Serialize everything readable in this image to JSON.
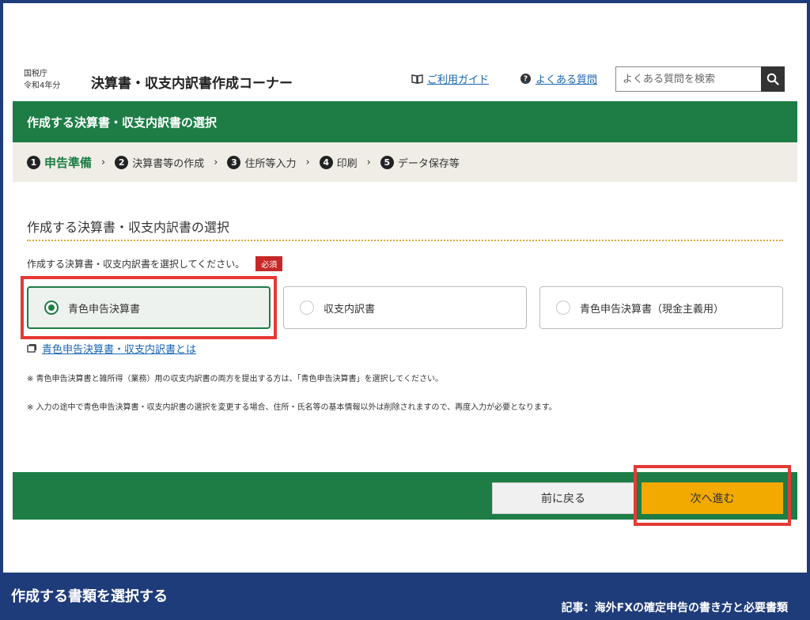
{
  "header": {
    "agency": "国税庁",
    "year": "令和4年分",
    "title": "決算書・収支内訳書作成コーナー",
    "guide_link": "ご利用ガイド",
    "faq_link": "よくある質問",
    "search_placeholder": "よくある質問を検索"
  },
  "page_heading": "作成する決算書・収支内訳書の選択",
  "steps": [
    {
      "num": "1",
      "label": "申告準備"
    },
    {
      "num": "2",
      "label": "決算書等の作成"
    },
    {
      "num": "3",
      "label": "住所等入力"
    },
    {
      "num": "4",
      "label": "印刷"
    },
    {
      "num": "5",
      "label": "データ保存等"
    }
  ],
  "section": {
    "title": "作成する決算書・収支内訳書の選択",
    "instruction": "作成する決算書・収支内訳書を選択してください。",
    "required": "必須",
    "options": [
      {
        "label": "青色申告決算書"
      },
      {
        "label": "収支内訳書"
      },
      {
        "label": "青色申告決算書（現金主義用）"
      }
    ],
    "info_link": "青色申告決算書・収支内訳書とは",
    "notes": [
      "※ 青色申告決算書と雑所得（業務）用の収支内訳書の両方を提出する方は、「青色申告決算書」を選択してください。",
      "※ 入力の途中で青色申告決算書・収支内訳書の選択を変更する場合、住所・氏名等の基本情報以外は削除されますので、再度入力が必要となります。"
    ]
  },
  "buttons": {
    "back": "前に戻る",
    "next": "次へ進む"
  },
  "caption": {
    "left": "作成する書類を選択する",
    "right": "記事：海外FXの確定申告の書き方と必要書類"
  },
  "colors": {
    "green": "#1d7d45",
    "accent": "#f2a900",
    "highlight": "#e53935",
    "navy": "#1f3c7a"
  }
}
